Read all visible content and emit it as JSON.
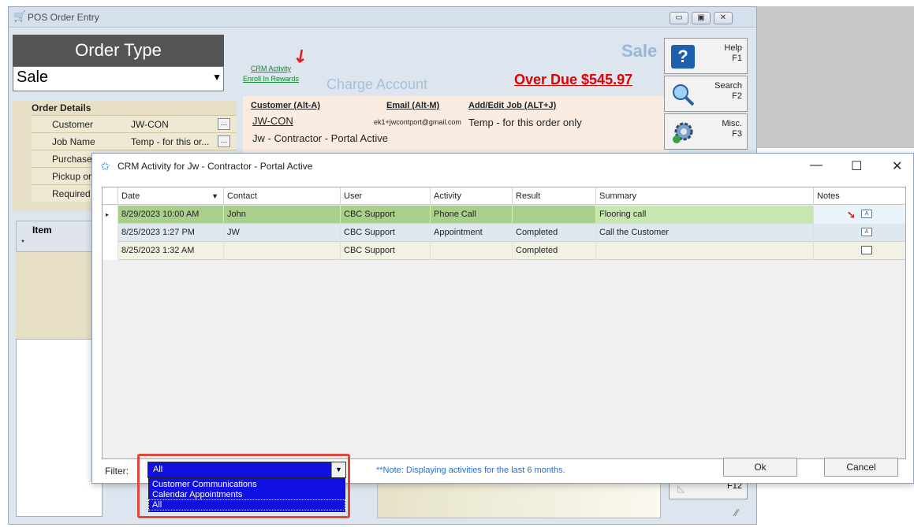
{
  "pos_window": {
    "title": "POS Order Entry",
    "order_type_label": "Order Type",
    "order_type_value": "Sale",
    "order_details_title": "Order Details",
    "details_rows": [
      {
        "label": "Customer",
        "value": "JW-CON"
      },
      {
        "label": "Job Name",
        "value": "Temp - for this or..."
      },
      {
        "label": "Purchase",
        "value": ""
      },
      {
        "label": "Pickup or",
        "value": ""
      },
      {
        "label": "Required",
        "value": ""
      }
    ],
    "crm_activity_link": "CRM Activity",
    "enroll_rewards_link": "Enroll In Rewards",
    "charge_account": "Charge Account",
    "sale_title": "Sale",
    "over_due": "Over Due $545.97",
    "customer_header": "Customer (Alt-A)",
    "email_header": "Email (Alt-M)",
    "job_header": "Add/Edit Job (ALT+J)",
    "customer_id": "JW-CON",
    "customer_email": "ek1+jwcontport@gmail.com",
    "customer_name": "Jw - Contractor - Portal Active",
    "job_text": "Temp - for this order only",
    "buttons": {
      "help": {
        "line1": "Help",
        "line2": "F1",
        "icon": "help-icon"
      },
      "search": {
        "line1": "Search",
        "line2": "F2",
        "icon": "search-icon"
      },
      "misc": {
        "line1": "Misc.",
        "line2": "F3",
        "icon": "gear-icon"
      },
      "f12": "F12"
    },
    "item_header": "Item",
    "new_row_marker": "*"
  },
  "crm_dialog": {
    "title": "CRM Activity for Jw - Contractor - Portal Active",
    "columns": [
      "Date",
      "Contact",
      "User",
      "Activity",
      "Result",
      "Summary",
      "Notes"
    ],
    "rows": [
      {
        "date": "8/29/2023 10:00 AM",
        "contact": "John",
        "user": "CBC Support",
        "activity": "Phone Call",
        "result": "",
        "summary": "Flooring call",
        "note": "note-with-text"
      },
      {
        "date": "8/25/2023 1:27 PM",
        "contact": "JW",
        "user": "CBC Support",
        "activity": "Appointment",
        "result": "Completed",
        "summary": "Call the Customer",
        "note": "note-with-text"
      },
      {
        "date": "8/25/2023 1:32 AM",
        "contact": "",
        "user": "CBC Support",
        "activity": "",
        "result": "Completed",
        "summary": "",
        "note": "note-empty"
      }
    ],
    "filter_label": "Filter:",
    "filter_value": "All",
    "filter_options": [
      "Customer Communications",
      "Calendar Appointments",
      "All"
    ],
    "note": "**Note:  Displaying activities for the last 6 months.",
    "ok_button": "Ok",
    "cancel_button": "Cancel"
  },
  "colors": {
    "selected_row": "#a8d08a",
    "dropdown_bg": "#1010e0",
    "highlight_box": "#e0473a",
    "overdue": "#e00000"
  }
}
